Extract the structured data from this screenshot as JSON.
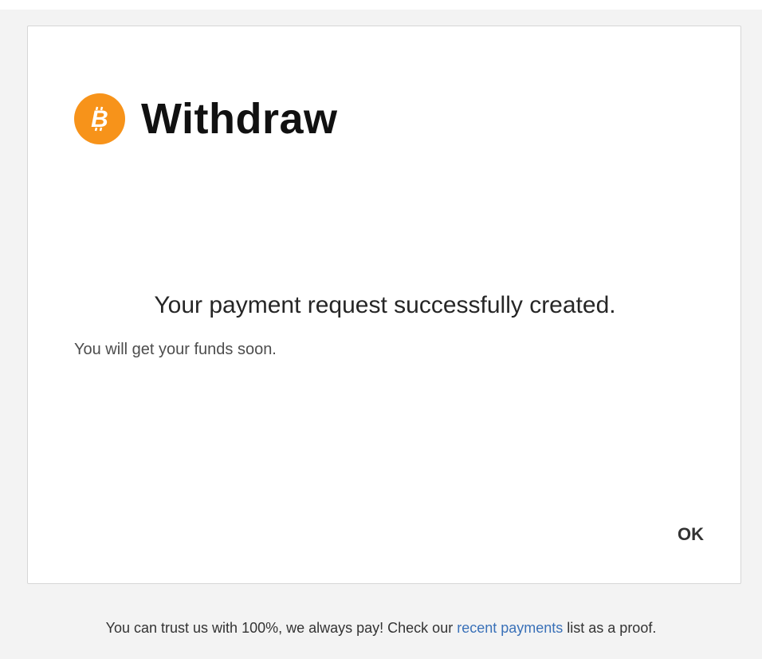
{
  "dialog": {
    "title": "Withdraw",
    "icon": "bitcoin-icon",
    "icon_color": "#f7931a",
    "message": "Your payment request successfully created.",
    "submessage": "You will get your funds soon.",
    "ok_label": "OK"
  },
  "footer": {
    "text_before": "You can trust us with 100%, we always pay! Check our ",
    "link_text": "recent payments",
    "text_after": " list as a proof.",
    "link_color": "#3a71b8"
  }
}
